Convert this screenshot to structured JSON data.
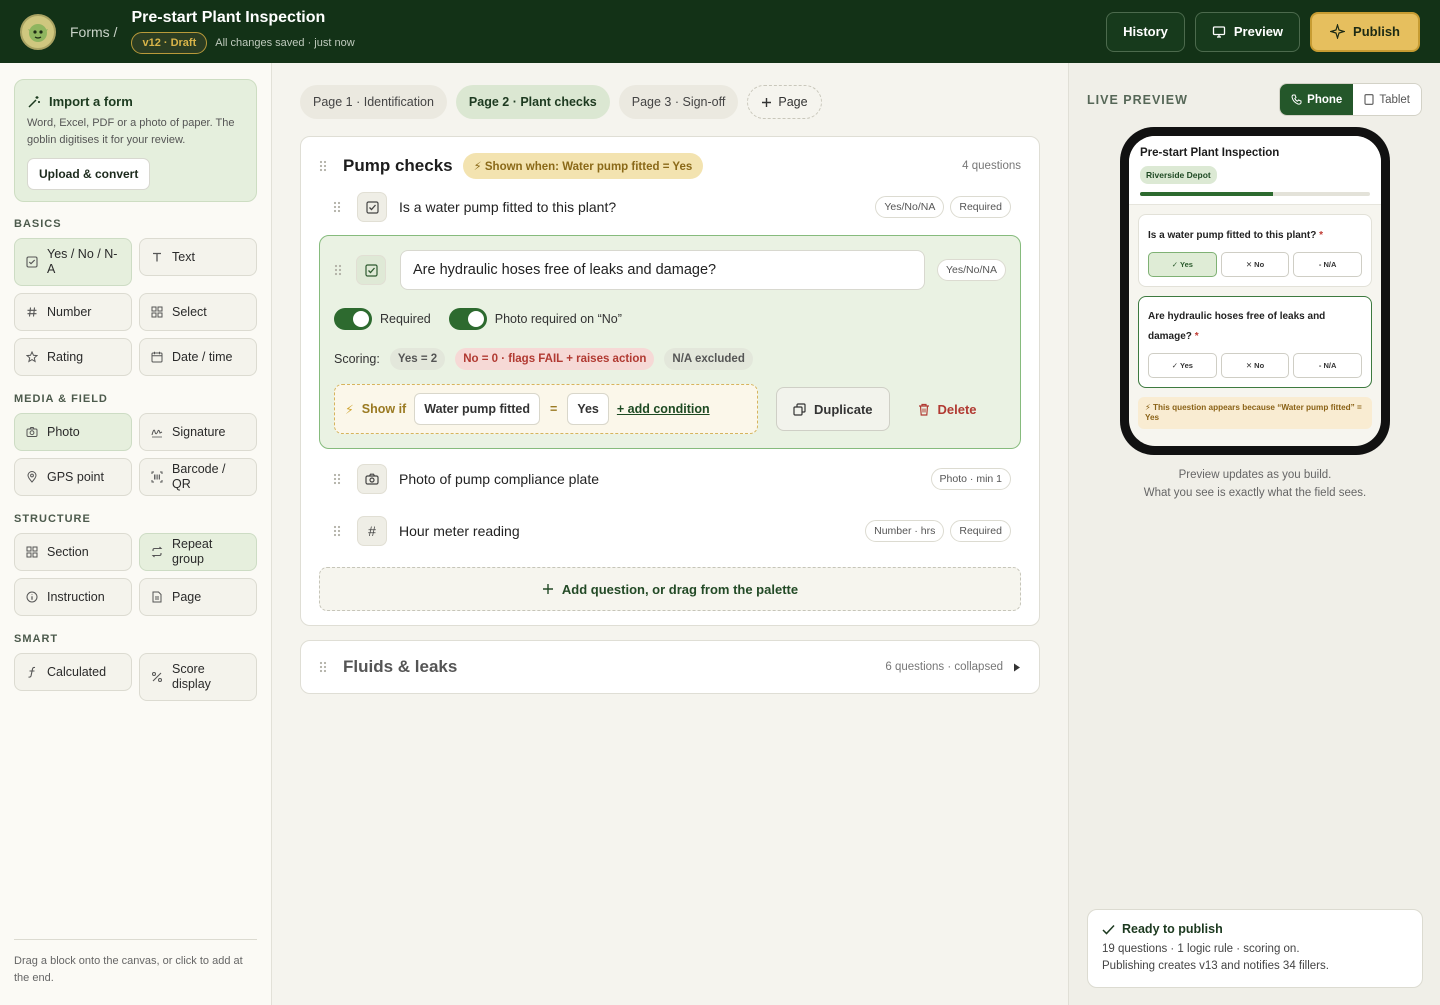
{
  "header": {
    "breadcrumb": "Forms /",
    "title": "Pre-start Plant Inspection",
    "version": "v12 · Draft",
    "save_status": "All changes saved · just now",
    "history": "History",
    "preview": "Preview",
    "publish": "Publish"
  },
  "sidebar": {
    "import_title": "Import a form",
    "import_desc": "Word, Excel, PDF or a photo of paper. The goblin digitises it for your review.",
    "upload_label": "Upload & convert",
    "categories": [
      {
        "name": "BASICS",
        "blocks": [
          {
            "label": "Yes / No / N-A",
            "icon": "checkbox-icon"
          },
          {
            "label": "Text",
            "icon": "text-icon"
          },
          {
            "label": "Number",
            "icon": "hash-icon"
          },
          {
            "label": "Select",
            "icon": "grid-icon"
          },
          {
            "label": "Rating",
            "icon": "star-icon"
          },
          {
            "label": "Date / time",
            "icon": "calendar-icon"
          }
        ]
      },
      {
        "name": "MEDIA & FIELD",
        "blocks": [
          {
            "label": "Photo",
            "icon": "camera-icon"
          },
          {
            "label": "Signature",
            "icon": "signature-icon"
          },
          {
            "label": "GPS point",
            "icon": "pin-icon"
          },
          {
            "label": "Barcode / QR",
            "icon": "barcode-icon"
          }
        ]
      },
      {
        "name": "STRUCTURE",
        "blocks": [
          {
            "label": "Section",
            "icon": "grid-icon"
          },
          {
            "label": "Repeat group",
            "icon": "repeat-icon"
          },
          {
            "label": "Instruction",
            "icon": "info-icon"
          },
          {
            "label": "Page",
            "icon": "page-icon"
          }
        ]
      },
      {
        "name": "SMART",
        "blocks": [
          {
            "label": "Calculated",
            "icon": "function-icon"
          },
          {
            "label": "Score display",
            "icon": "percent-icon"
          }
        ]
      }
    ],
    "hint": "Drag a block onto the canvas, or click to add at the end."
  },
  "tabs": [
    {
      "label": "Page 1 · Identification"
    },
    {
      "label": "Page 2 · Plant checks"
    },
    {
      "label": "Page 3 · Sign-off"
    },
    {
      "label": "Page"
    }
  ],
  "section": {
    "title": "Pump checks",
    "condition": "Shown when: Water pump fitted = Yes",
    "count": "4 questions",
    "q1": {
      "text": "Is a water pump fitted to this plant?",
      "type": "Yes/No/NA",
      "required": "Required"
    },
    "q2": {
      "text": "Are hydraulic hoses free of leaks and damage?",
      "type": "Yes/No/NA",
      "required_label": "Required",
      "photo_label": "Photo required on “No”",
      "scoring_label": "Scoring:",
      "score_yes": "Yes = 2",
      "score_no": "No = 0 · flags FAIL + raises action",
      "score_na": "N/A excluded",
      "showif_label": "Show if",
      "showif_field": "Water pump fitted",
      "showif_op": "=",
      "showif_value": "Yes",
      "add_condition": "+ add condition",
      "duplicate": "Duplicate",
      "delete": "Delete"
    },
    "q3": {
      "text": "Photo of pump compliance plate",
      "type": "Photo · min 1"
    },
    "q4": {
      "text": "Hour meter reading",
      "type": "Number · hrs",
      "required": "Required"
    },
    "add_question": "Add question, or drag from the palette"
  },
  "collapsed_section": {
    "title": "Fluids & leaks",
    "meta": "6 questions · collapsed"
  },
  "preview": {
    "label": "LIVE PREVIEW",
    "phone": "Phone",
    "tablet": "Tablet",
    "form_title": "Pre-start Plant Inspection",
    "depot": "Riverside Depot",
    "progress": 0.58,
    "q1": "Is a water pump fitted to this plant?",
    "q2": "Are hydraulic hoses free of leaks and damage?",
    "req_star": "*",
    "opt_yes": "✓ Yes",
    "opt_no": "✕ No",
    "opt_na": "- N/A",
    "note": "⚡ This question appears because “Water pump fitted” = Yes",
    "caption1": "Preview updates as you build.",
    "caption2": "What you see is exactly what the field sees."
  },
  "ready": {
    "title": "Ready to publish",
    "line1": "19 questions · 1 logic rule · scoring on.",
    "line2": "Publishing creates v13 and notifies 34 fillers."
  }
}
